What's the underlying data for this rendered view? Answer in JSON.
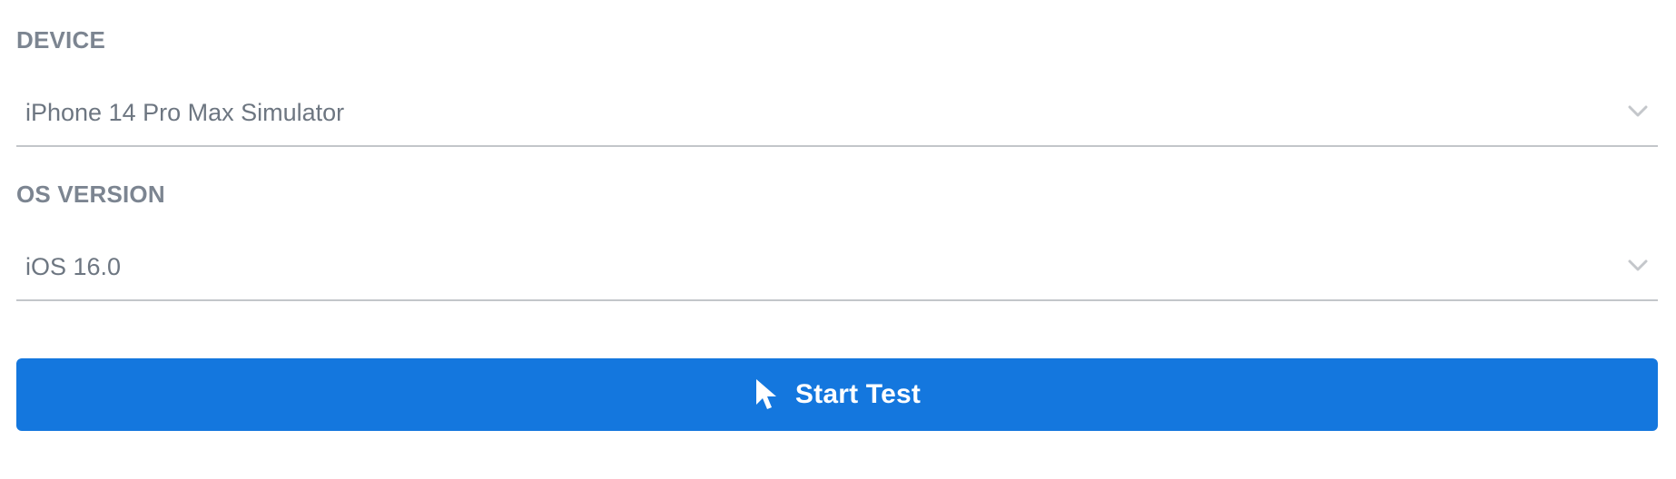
{
  "form": {
    "device": {
      "label": "DEVICE",
      "selected": "iPhone 14 Pro Max Simulator",
      "icon": "chevron-down-icon"
    },
    "os_version": {
      "label": "OS VERSION",
      "selected": "iOS 16.0",
      "icon": "chevron-down-icon"
    },
    "start_button": {
      "label": "Start Test",
      "icon": "cursor-pointer-icon",
      "color": "#1477de"
    }
  }
}
